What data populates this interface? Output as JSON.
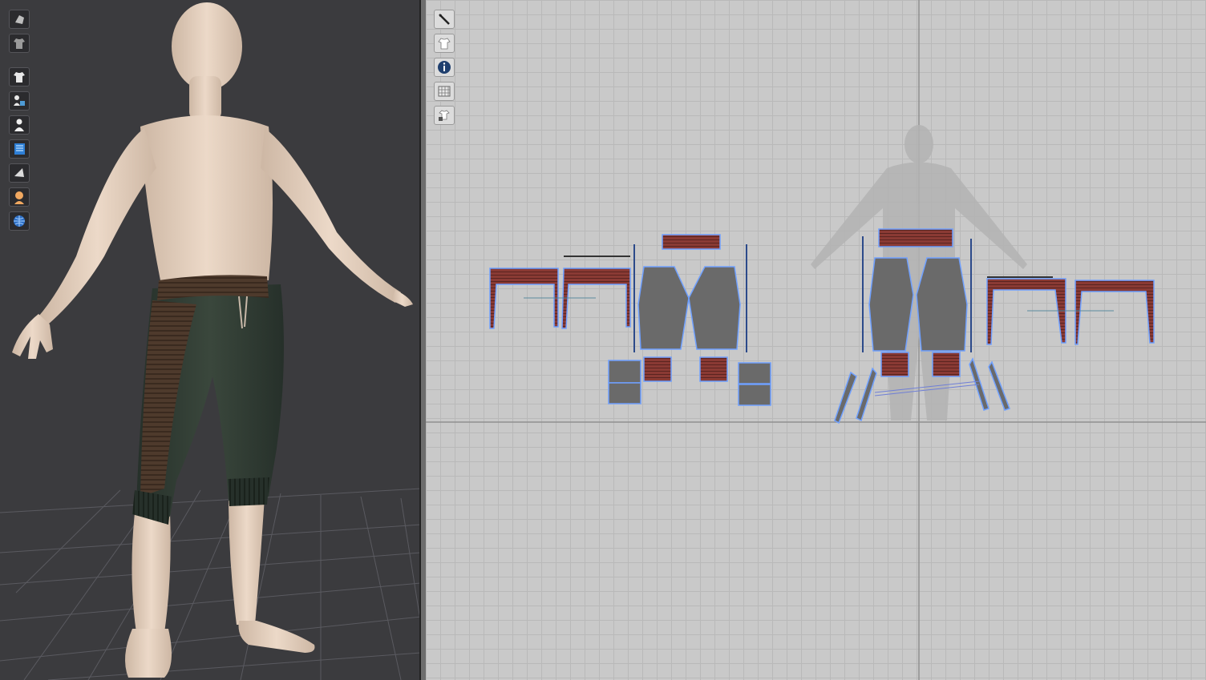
{
  "app": {
    "panels": [
      "3d-avatar-window",
      "2d-pattern-window"
    ]
  },
  "toolbar_3d": {
    "icons": [
      "avatar-display-icon",
      "garment-display-icon",
      "show-garment-icon",
      "show-avatar-icon",
      "avatar-silhouette-icon",
      "texture-display-icon",
      "render-mode-icon",
      "skin-display-icon",
      "environment-globe-icon"
    ]
  },
  "toolbar_2d": {
    "icons": [
      "edit-pattern-icon",
      "show-garment-2d-icon",
      "info-icon",
      "grid-texture-icon",
      "lock-garment-icon"
    ]
  },
  "colors": {
    "viewport_3d_bg": "#3b3b3e",
    "viewport_2d_bg": "#c9c9c9",
    "pattern_fill": "#6a6a6a",
    "rib_fill": "#8a3a34",
    "pants_green": "#323d33",
    "waistband_brown": "#4e3a2c",
    "skin": "#e6d2c0",
    "selection_blue": "#6fa0ff"
  }
}
